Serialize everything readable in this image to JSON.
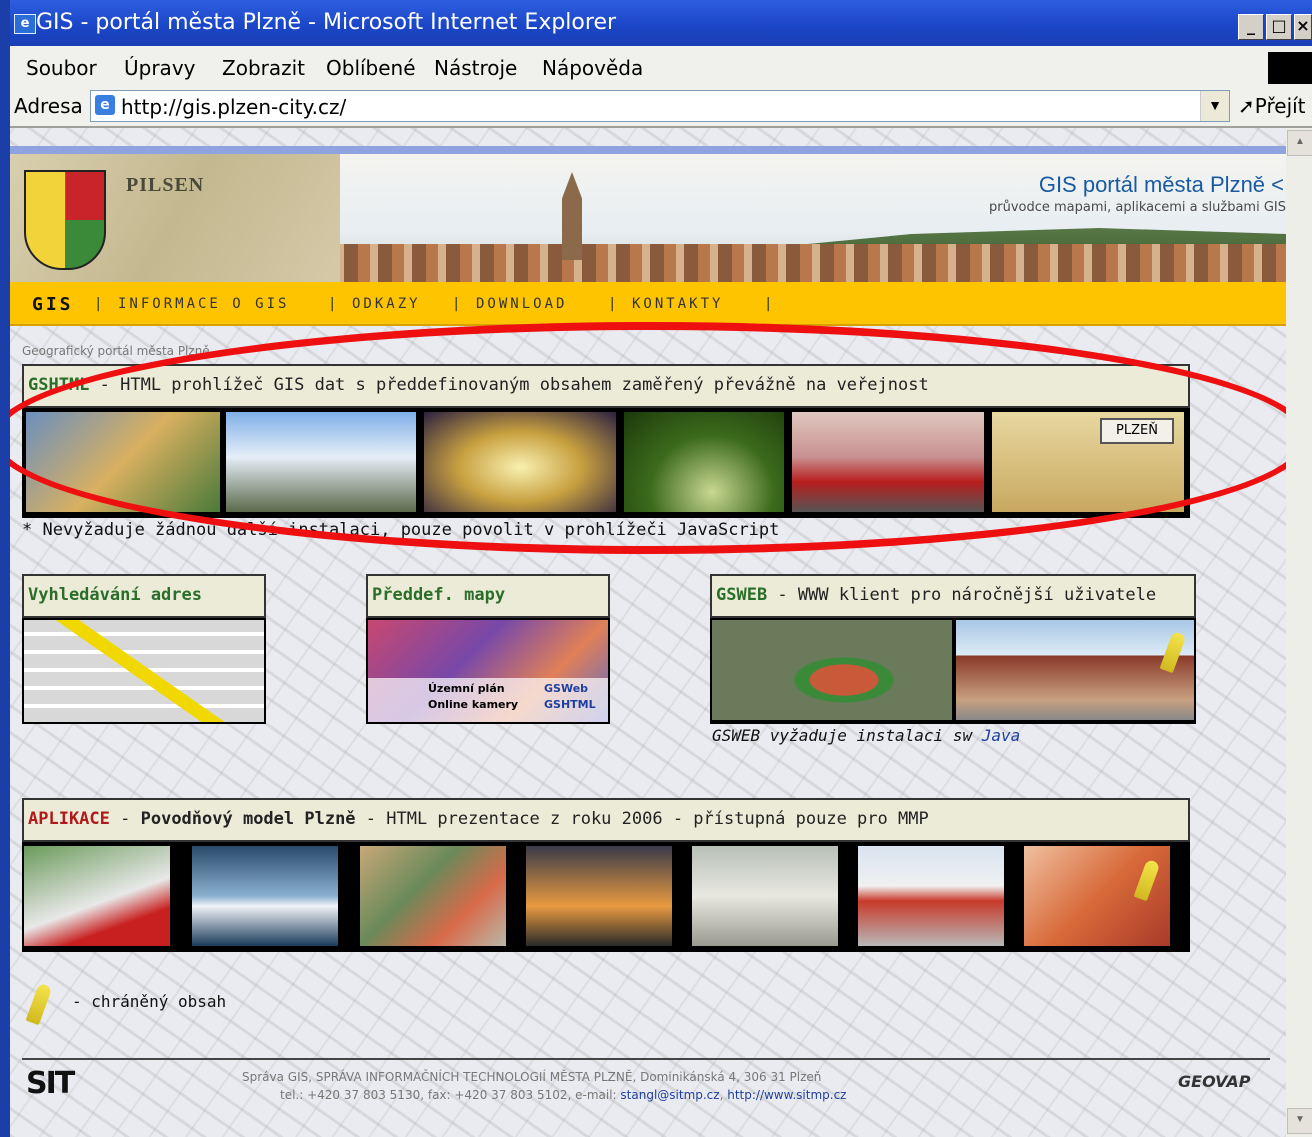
{
  "window": {
    "title": "GIS - portál města Plzně - Microsoft Internet Explorer",
    "icon": "ie-icon",
    "controls": {
      "minimize": "_",
      "maximize": "□",
      "close": "×"
    }
  },
  "menu": [
    "Soubor",
    "Úpravy",
    "Zobrazit",
    "Oblíbené",
    "Nástroje",
    "Nápověda"
  ],
  "address": {
    "label": "Adresa",
    "url": "http://gis.plzen-city.cz/",
    "go": "Přejít"
  },
  "banner": {
    "pilsen": "PILSEN",
    "title": "GIS portál města Plzně <",
    "tagline": "průvodce mapami, aplikacemi a službami GIS"
  },
  "nav": [
    {
      "label": "GIS"
    },
    {
      "label": "INFORMACE O GIS"
    },
    {
      "label": "ODKAZY"
    },
    {
      "label": "DOWNLOAD"
    },
    {
      "label": "KONTAKTY"
    }
  ],
  "nav_sep": "|",
  "breadcrumb": "Geografický portál města Plzně",
  "gshtml": {
    "name": "GSHTML",
    "desc": " - HTML prohlížeč GIS dat s předdefinovaným obsahem zaměřený převážně na veřejnost",
    "note": "* Nevyžaduje žádnou další instalaci, pouze povolit v prohlížeči JavaScript",
    "plzen_sign": "PLZEŇ",
    "thumbs": [
      "thumb-collage",
      "thumb-mountain-bike",
      "thumb-theatre",
      "thumb-tree-alley",
      "thumb-tram",
      "thumb-plzen-map"
    ]
  },
  "address_search": {
    "title": "Vyhledávání adres"
  },
  "predef_maps": {
    "title": "Předdef. mapy",
    "row1": "Územní plán",
    "row1_link": "GSWeb",
    "row2": "Online kamery",
    "row2_link": "GSHTML"
  },
  "gsweb": {
    "name": "GSWEB",
    "desc": " - WWW klient pro náročnější uživatele",
    "note": "GSWEB vyžaduje instalaci sw ",
    "note_link": "Java"
  },
  "apps": {
    "label": "APLIKACE",
    "sep": " - ",
    "name": "Povodňový model Plzně",
    "desc": " - HTML prezentace z roku 2006 - přístupná pouze pro MMP",
    "thumbs": [
      "thumb-3d-model",
      "thumb-river",
      "thumb-money",
      "thumb-chimney",
      "thumb-containers",
      "thumb-road-barrier",
      "thumb-flood"
    ]
  },
  "legend": {
    "text": "- chráněný obsah"
  },
  "footer": {
    "logo_left": "SIT",
    "line1": "Správa GIS, SPRÁVA INFORMAČNÍCH TECHNOLOGIÍ MĚSTA PLZNĚ, Dominikánská 4, 306 31 Plzeň",
    "line2": "tel.: +420 37 803 5130, fax: +420 37 803 5102, e-mail: ",
    "email": "stangl@sitmp.cz",
    "comma": ", ",
    "web": "http://www.sitmp.cz",
    "logo_right": "GEOVAP"
  },
  "colors": {
    "nav_bg": "#ffc400",
    "title_bar": "#1b46c8",
    "highlight_ellipse": "#ee1010",
    "green_title": "#2a6e2a",
    "red_label": "#b01a1a"
  }
}
